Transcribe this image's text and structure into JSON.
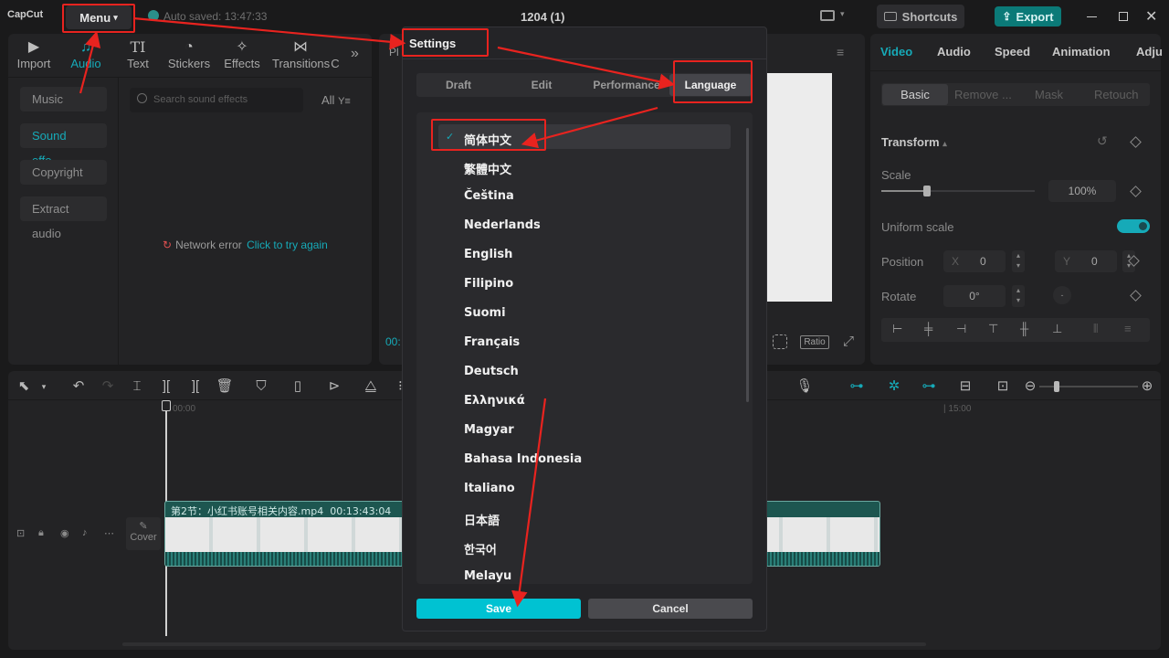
{
  "app": {
    "logo": "CapCut",
    "menu_label": "Menu",
    "autosave": "Auto saved: 13:47:33",
    "project_title": "1204 (1)",
    "shortcuts": "Shortcuts",
    "export": "Export"
  },
  "left": {
    "tools": [
      {
        "label": "Import",
        "icon": "import-icon"
      },
      {
        "label": "Audio",
        "icon": "audio-icon"
      },
      {
        "label": "Text",
        "icon": "text-icon"
      },
      {
        "label": "Stickers",
        "icon": "stickers-icon"
      },
      {
        "label": "Effects",
        "icon": "effects-icon"
      },
      {
        "label": "Transitions",
        "icon": "transitions-icon"
      },
      {
        "label": "C",
        "icon": ""
      }
    ],
    "sidebar": [
      "Music",
      "Sound effe...",
      "Copyright",
      "Extract audio"
    ],
    "search_placeholder": "Search sound effects",
    "filter_label": "All",
    "network_error": "Network error",
    "retry": "Click to try again"
  },
  "player": {
    "tab_partial": "Pl",
    "time_partial": "00:",
    "ratio": "Ratio"
  },
  "right": {
    "tabs": [
      "Video",
      "Audio",
      "Speed",
      "Animation",
      "Adju"
    ],
    "subtabs": [
      "Basic",
      "Remove ...",
      "Mask",
      "Retouch"
    ],
    "transform": "Transform",
    "scale_label": "Scale",
    "scale_value": "100%",
    "scale_level": 0.3,
    "uniform_scale": "Uniform scale",
    "position_label": "Position",
    "x_label": "X",
    "x_value": "0",
    "y_label": "Y",
    "y_value": "0",
    "rotate_label": "Rotate",
    "rotate_value": "0°"
  },
  "timeline": {
    "time_start": "00:00",
    "time_mark": "| 15:00",
    "clip_label": "第2节：小红书账号相关内容.mp4",
    "clip_duration": "00:13:43:04",
    "cover": "Cover"
  },
  "settings": {
    "title": "Settings",
    "tabs": [
      "Draft",
      "Edit",
      "Performance",
      "Language"
    ],
    "active_tab": "Language",
    "languages": [
      "简体中文",
      "繁體中文",
      "Čeština",
      "Nederlands",
      "English",
      "Filipino",
      "Suomi",
      "Français",
      "Deutsch",
      "Ελληνικά",
      "Magyar",
      "Bahasa Indonesia",
      "Italiano",
      "日本語",
      "한국어",
      "Melayu"
    ],
    "selected_language": "简体中文",
    "save": "Save",
    "cancel": "Cancel"
  },
  "colors": {
    "accent": "#00c2d2",
    "annotation": "#e8231f",
    "export_bg": "#0b7a78"
  }
}
